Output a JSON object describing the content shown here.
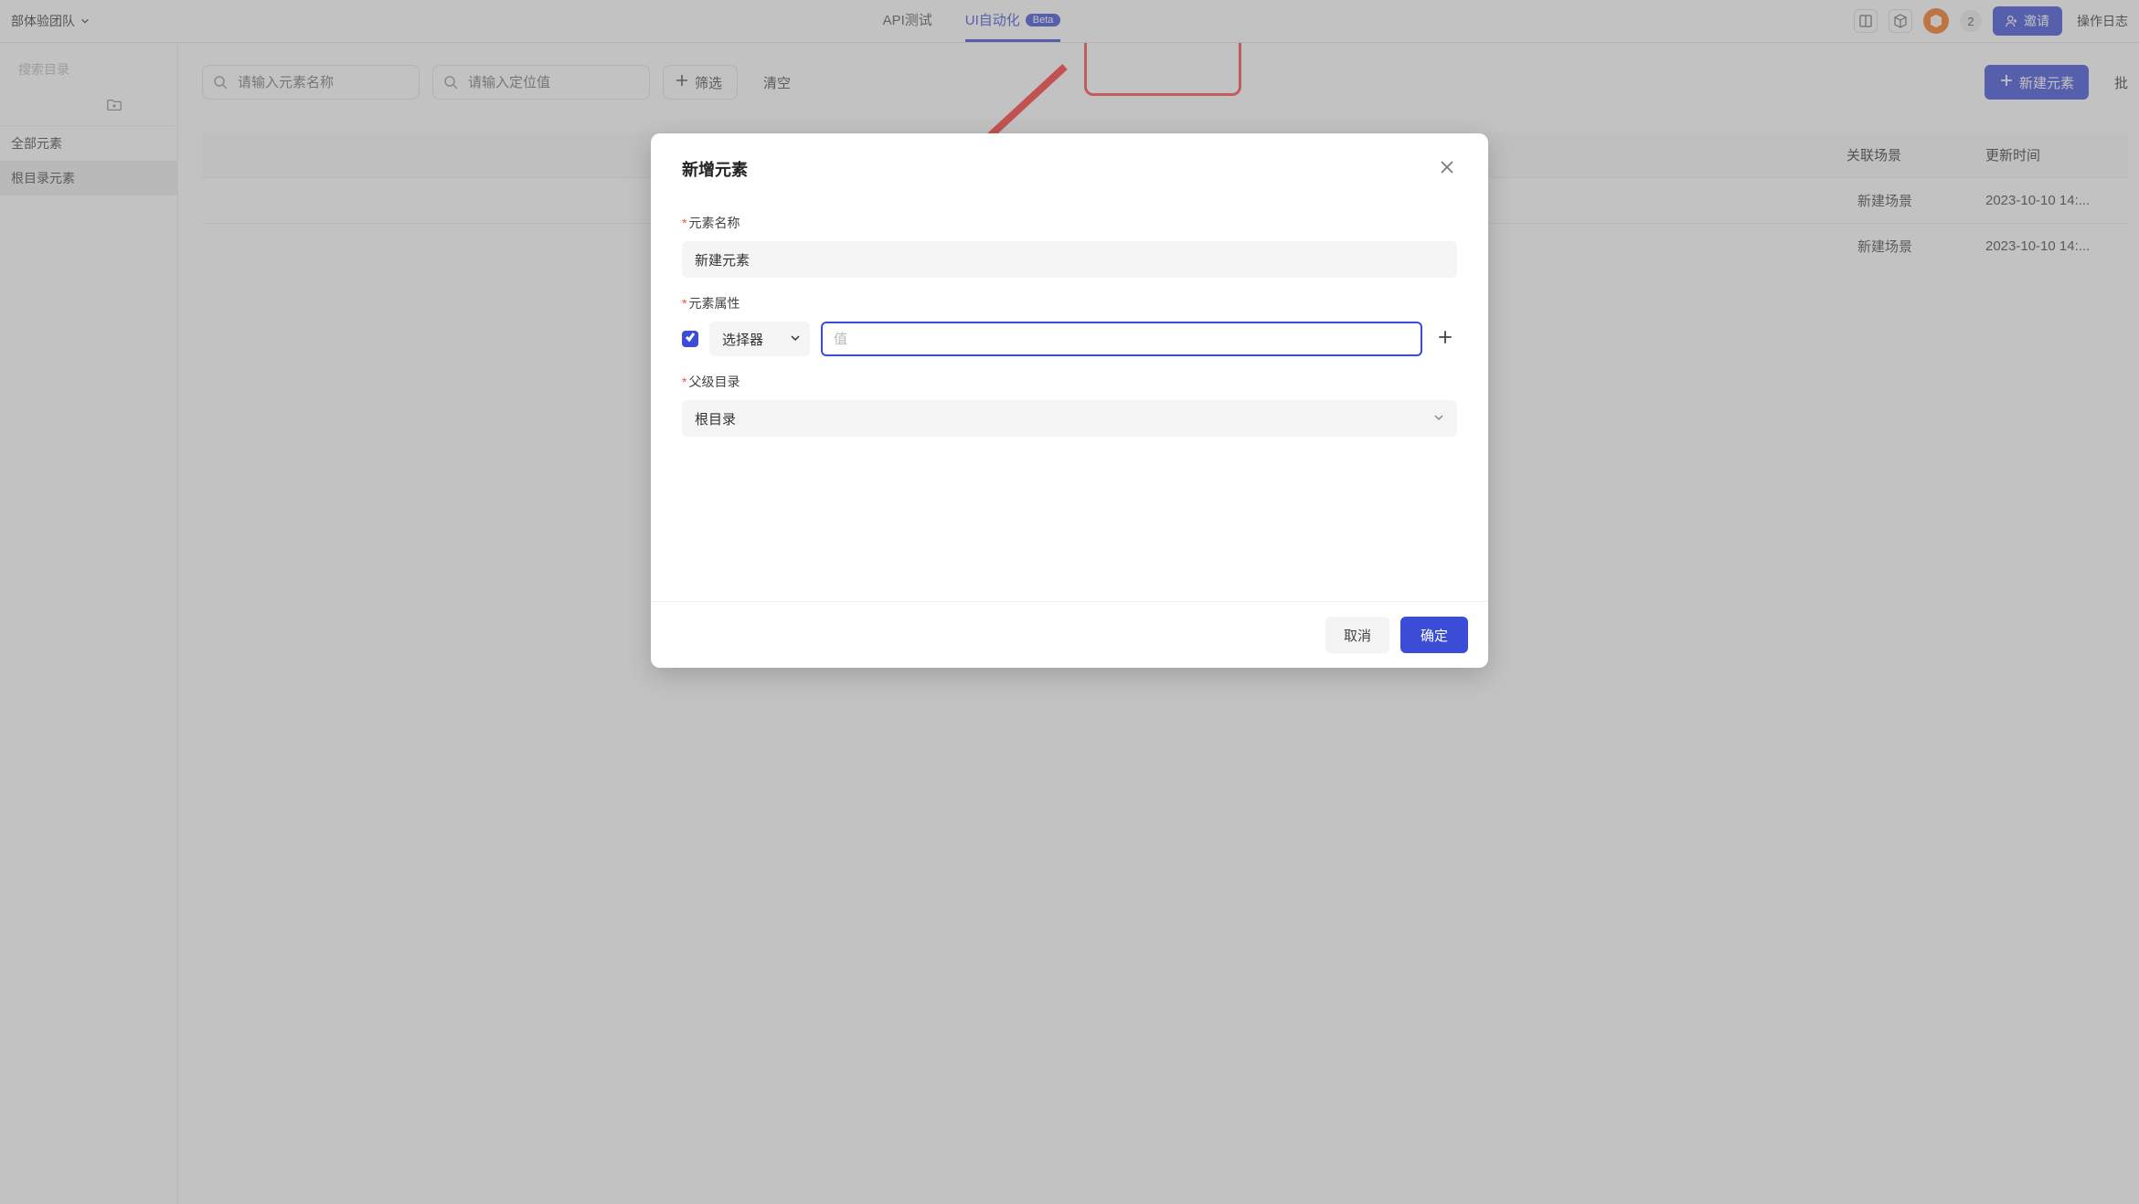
{
  "topbar": {
    "team_name": "部体验团队",
    "nav": {
      "api_test": "API测试",
      "ui_auto": "UI自动化",
      "beta": "Beta"
    },
    "notif_count": "2",
    "invite": "邀请",
    "oplog": "操作日志"
  },
  "sidebar": {
    "search_placeholder": "搜索目录",
    "items": [
      {
        "label": "全部元素"
      },
      {
        "label": "根目录元素"
      }
    ]
  },
  "toolbar": {
    "name_placeholder": "请输入元素名称",
    "locator_placeholder": "请输入定位值",
    "filter": "筛选",
    "clear": "清空",
    "create": "新建元素",
    "batch": "批"
  },
  "table": {
    "headers": {
      "scene": "关联场景",
      "updated": "更新时间"
    },
    "rows": [
      {
        "scene": "新建场景",
        "updated": "2023-10-10 14:..."
      },
      {
        "scene": "新建场景",
        "updated": "2023-10-10 14:..."
      }
    ]
  },
  "modal": {
    "title": "新增元素",
    "name_label": "元素名称",
    "name_value": "新建元素",
    "attr_label": "元素属性",
    "selector_label": "选择器",
    "value_placeholder": "值",
    "parent_label": "父级目录",
    "parent_value": "根目录",
    "cancel": "取消",
    "ok": "确定"
  }
}
